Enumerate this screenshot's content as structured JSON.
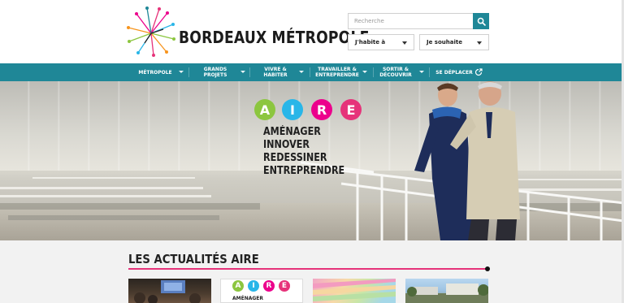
{
  "header": {
    "logo_text": "BORDEAUX MÉTROPOLE",
    "search": {
      "placeholder": "Recherche"
    },
    "selects": [
      {
        "label": "J'habite à"
      },
      {
        "label": "Je souhaite"
      }
    ]
  },
  "nav": {
    "items": [
      {
        "label": "MÉTROPOLE",
        "has_dropdown": true
      },
      {
        "label": "GRANDS PROJETS",
        "has_dropdown": true
      },
      {
        "label": "VIVRE & HABITER",
        "has_dropdown": true
      },
      {
        "label": "TRAVAILLER & ENTREPRENDRE",
        "has_dropdown": true
      },
      {
        "label": "SORTIR & DÉCOUVRIR",
        "has_dropdown": true
      },
      {
        "label": "SE DÉPLACER",
        "has_dropdown": false
      }
    ]
  },
  "hero": {
    "aire_letters": [
      "A",
      "I",
      "R",
      "E"
    ],
    "lines": [
      "AMÉNAGER",
      "INNOVER",
      "REDESSINER",
      "ENTREPRENDRE"
    ]
  },
  "news": {
    "title": "LES ACTUALITÉS AIRE",
    "card2_text": "AMÉNAGER",
    "card2_letters": [
      "A",
      "I",
      "R",
      "E"
    ]
  },
  "colors": {
    "teal": "#1f8797",
    "pink": "#e6337a",
    "aire_green": "#8cc63f",
    "aire_cyan": "#29b6e8",
    "aire_pink": "#e6337a",
    "aire_magenta": "#ec008c"
  }
}
